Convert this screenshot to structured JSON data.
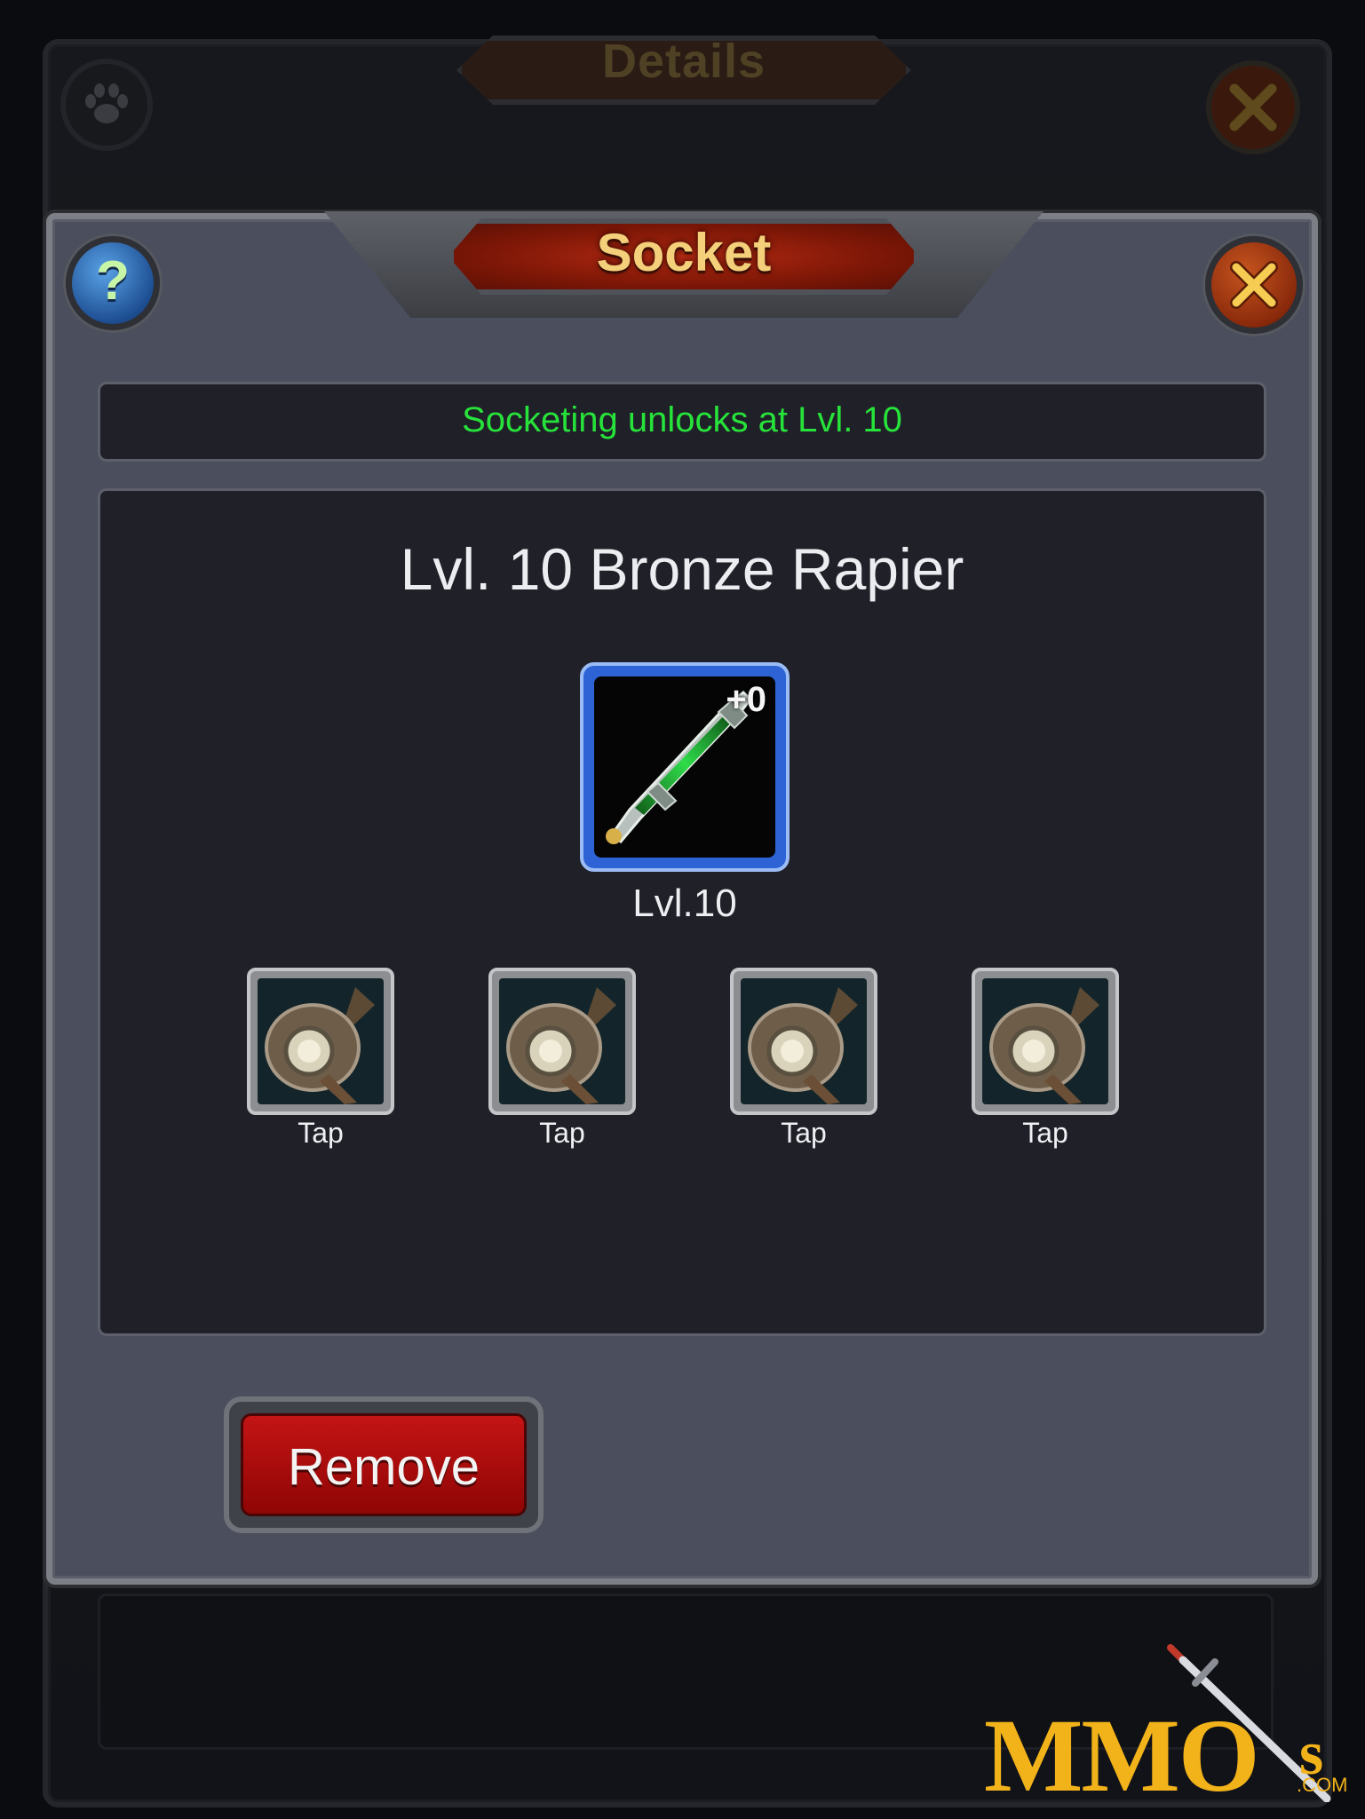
{
  "background_window": {
    "title": "Details"
  },
  "dialog": {
    "title": "Socket",
    "help_label": "?",
    "notice": "Socketing unlocks at Lvl. 10",
    "item": {
      "name": "Lvl. 10 Bronze Rapier",
      "enhancement": "+0",
      "level_label": "Lvl.10"
    },
    "sockets": [
      {
        "label": "Tap"
      },
      {
        "label": "Tap"
      },
      {
        "label": "Tap"
      },
      {
        "label": "Tap"
      }
    ],
    "remove_label": "Remove"
  },
  "watermark": {
    "brand": "MMO",
    "suffix": "s",
    "domain": ".COM"
  },
  "colors": {
    "notice_text": "#27e23a",
    "title_text": "#f4d07a",
    "remove_button": "#b30c0c",
    "item_frame": "#2d63d4",
    "watermark": "#f2b21a"
  }
}
